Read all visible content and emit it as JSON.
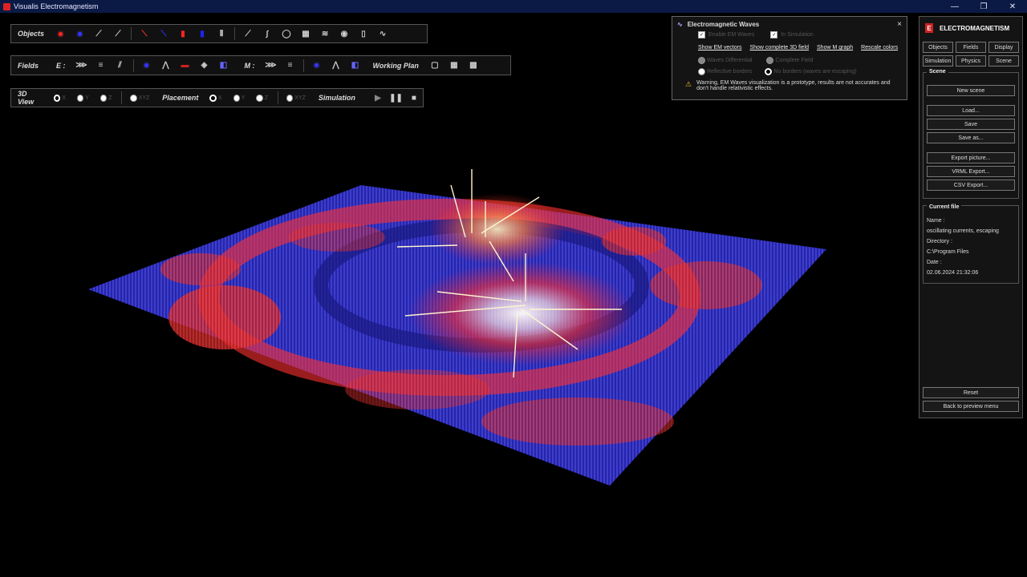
{
  "window": {
    "title": "Visualis Electromagnetism",
    "controls": [
      "—",
      "❐",
      "✕"
    ]
  },
  "toolbar_objects": {
    "label": "Objects"
  },
  "toolbar_fields": {
    "label": "Fields",
    "e_label": "E :",
    "m_label": "M :",
    "working_plan": "Working Plan"
  },
  "toolbar_view": {
    "view_label": "3D View",
    "view_options": [
      "X",
      "Y",
      "Z",
      "XYZ"
    ],
    "placement_label": "Placement",
    "placement_options": [
      "X",
      "Y",
      "Z",
      "XYZ"
    ],
    "simulation_label": "Simulation"
  },
  "em_panel": {
    "title": "Electromagnetic Waves",
    "close": "×",
    "checkbox1": "Enable EM Waves",
    "checkbox2": "In Simulation",
    "link1": "Show EM vectors",
    "link2": "Show complete 3D field",
    "link3": "Show M graph",
    "link4": "Rescale colors",
    "radio1": "Waves Differential",
    "radio2": "Complete Field",
    "radio3": "Reflective borders",
    "radio4": "No borders (waves are escaping)",
    "warning": "Warning, EM Waves visualization is a prototype, results are not accurates and don't handle relativistic effects."
  },
  "right_panel": {
    "brand": "ELECTROMAGNETISM",
    "tabs": [
      "Objects",
      "Fields",
      "Display",
      "Simulation",
      "Physics",
      "Scene"
    ],
    "scene_title": "Scene",
    "new_scene": "New scene",
    "load": "Load...",
    "save": "Save",
    "save_as": "Save as...",
    "export_picture": "Export picture...",
    "vrml_export": "VRML Export...",
    "csv_export": "CSV Export...",
    "current_file_title": "Current file",
    "name_label": "Name :",
    "name_value": "oscillating currents, escaping",
    "directory_label": "Directory :",
    "directory_value": "C:\\Program Files",
    "date_label": "Date :",
    "date_value": "02.06.2024 21:32:06",
    "reset": "Reset",
    "back": "Back to preview menu"
  },
  "colors": {
    "titlebar": "#0a1a44",
    "field_red": "#ff3030",
    "field_blue": "#3a3aff",
    "warning": "#e8c020"
  }
}
